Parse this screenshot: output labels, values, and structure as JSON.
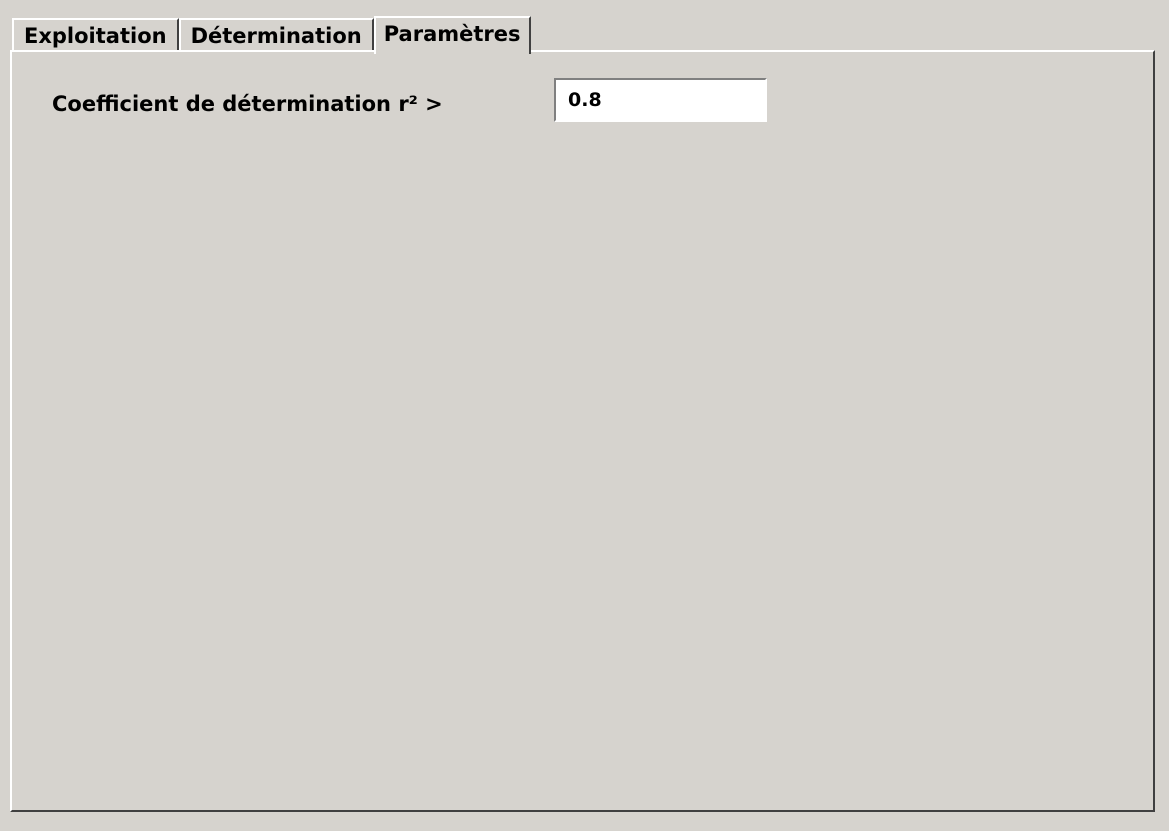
{
  "tabs": [
    {
      "label": "Exploitation",
      "active": false
    },
    {
      "label": "Détermination",
      "active": false
    },
    {
      "label": "Paramètres",
      "active": true
    }
  ],
  "parametres": {
    "r2_label": "Coefficient de détermination r² >",
    "r2_value": "0.8"
  },
  "colors": {
    "face": "#d6d3ce",
    "highlight": "#ffffff",
    "shadow": "#404040",
    "field": "#ffffff"
  }
}
